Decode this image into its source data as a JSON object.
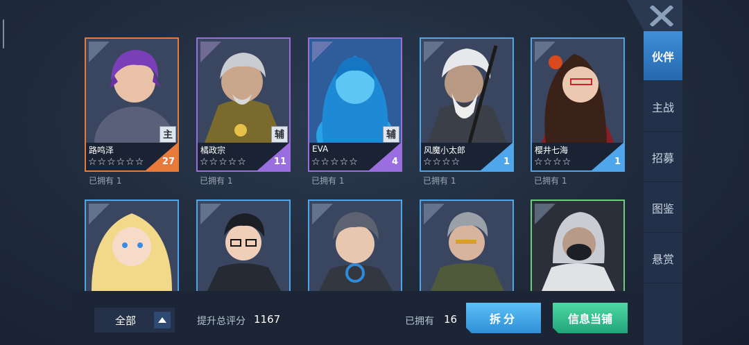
{
  "sidebar": {
    "close_icon": "close-x-icon",
    "items": [
      {
        "label": "伙伴",
        "active": true
      },
      {
        "label": "主战",
        "active": false
      },
      {
        "label": "招募",
        "active": false
      },
      {
        "label": "图鉴",
        "active": false
      },
      {
        "label": "悬赏",
        "active": false
      }
    ]
  },
  "partners": [
    {
      "name": "路鸣泽",
      "stars": "☆☆☆☆☆☆",
      "level": "27",
      "role": "主",
      "owned": "已拥有  1",
      "rarity_color": "#e87a3c"
    },
    {
      "name": "橘政宗",
      "stars": "☆☆☆☆☆",
      "level": "11",
      "role": "辅",
      "owned": "已拥有  1",
      "rarity_color": "#9b6ee0"
    },
    {
      "name": "EVA",
      "stars": "☆☆☆☆☆",
      "level": "4",
      "role": "辅",
      "owned": "已拥有  1",
      "rarity_color": "#9b6ee0"
    },
    {
      "name": "风魔小太郎",
      "stars": "☆☆☆☆",
      "level": "1",
      "role": "",
      "owned": "已拥有  1",
      "rarity_color": "#4fa6ea"
    },
    {
      "name": "樱井七海",
      "stars": "☆☆☆☆",
      "level": "1",
      "role": "",
      "owned": "已拥有  1",
      "rarity_color": "#4fa6ea"
    },
    {
      "name": "",
      "rarity_color": "#4fa6ea"
    },
    {
      "name": "",
      "rarity_color": "#4fa6ea"
    },
    {
      "name": "",
      "rarity_color": "#4fa6ea"
    },
    {
      "name": "",
      "rarity_color": "#4fa6ea"
    },
    {
      "name": "",
      "rarity_color": "#6ccf7d"
    }
  ],
  "bottom": {
    "filter_label": "全部",
    "score_label": "提升总评分",
    "score_value": "1167",
    "owned_label": "已拥有",
    "owned_value": "16",
    "split_button": "拆分",
    "shop_button": "信息当铺"
  }
}
